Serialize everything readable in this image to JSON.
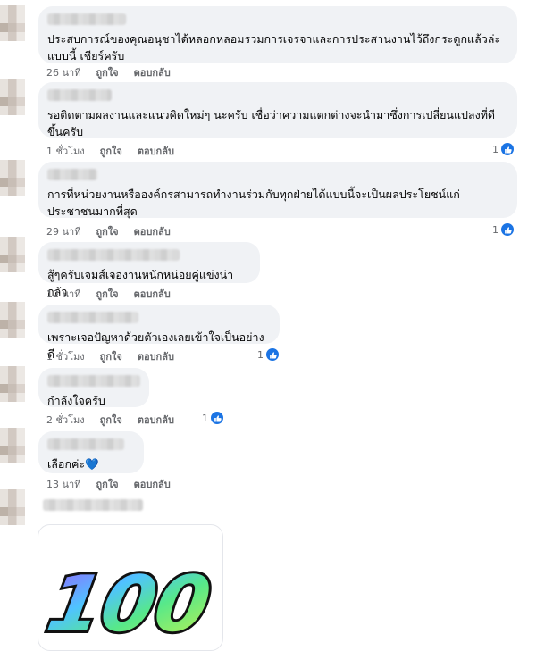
{
  "comments": [
    {
      "text": "ประสบการณ์ของคุณอนุชาได้หลอกหลอมรวมการเจรจาและการประสานงานไว้ถึงกระดูกแล้วล่ะ แบบนี้ เชียร์ครับ",
      "time": "26 นาที",
      "like_label": "ถูกใจ",
      "reply_label": "ตอบกลับ",
      "reactions": ""
    },
    {
      "text": "รอติดตามผลงานและแนวคิดใหม่ๆ นะครับ เชื่อว่าความแตกต่างจะนำมาซึ่งการเปลี่ยนแปลงที่ดีขึ้นครับ",
      "time": "1 ชั่วโมง",
      "like_label": "ถูกใจ",
      "reply_label": "ตอบกลับ",
      "reactions": "1"
    },
    {
      "text": "การที่หน่วยงานหรือองค์กรสามารถทำงานร่วมกับทุกฝ่ายได้แบบนี้จะเป็นผลประโยชน์แก่ประชาชนมากที่สุด",
      "time": "29 นาที",
      "like_label": "ถูกใจ",
      "reply_label": "ตอบกลับ",
      "reactions": "1"
    },
    {
      "text": "สู้ๆครับเจมส์เจองานหนักหน่อยคู่แข่งน่ากลัว",
      "time": "12 นาที",
      "like_label": "ถูกใจ",
      "reply_label": "ตอบกลับ",
      "reactions": ""
    },
    {
      "text": "เพราะเจอปัญหาด้วยตัวเองเลยเข้าใจเป็นอย่างดี",
      "time": "1 ชั่วโมง",
      "like_label": "ถูกใจ",
      "reply_label": "ตอบกลับ",
      "reactions": "1"
    },
    {
      "text": "กำลังใจครับ",
      "time": "2 ชั่วโมง",
      "like_label": "ถูกใจ",
      "reply_label": "ตอบกลับ",
      "reactions": "1"
    },
    {
      "text": "เลือกค่ะ💙",
      "time": "13 นาที",
      "like_label": "ถูกใจ",
      "reply_label": "ตอบกลับ",
      "reactions": ""
    }
  ],
  "sticker": {
    "text": "100",
    "icon": "sticker-100"
  },
  "colors": {
    "bubble": "#f0f2f5",
    "meta": "#65676b",
    "like_blue": "#1b74e4"
  }
}
